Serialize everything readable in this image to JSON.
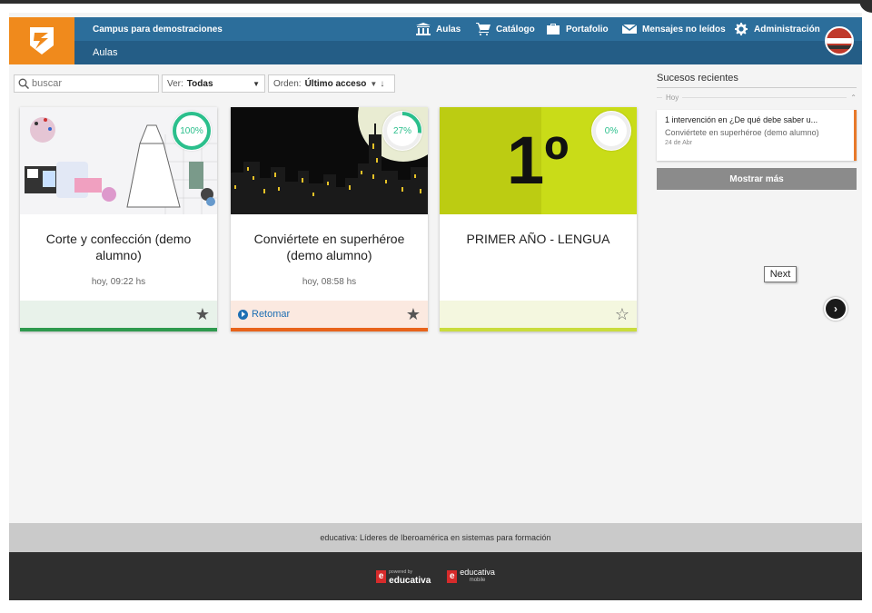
{
  "header": {
    "campus": "Campus para demostraciones",
    "section": "Aulas",
    "nav": [
      {
        "label": "Aulas",
        "icon": "building-icon"
      },
      {
        "label": "Catálogo",
        "icon": "cart-icon"
      },
      {
        "label": "Portafolio",
        "icon": "briefcase-icon"
      },
      {
        "label": "Mensajes no leídos",
        "icon": "envelope-icon"
      },
      {
        "label": "Administración",
        "icon": "gear-icon"
      }
    ]
  },
  "filters": {
    "search_placeholder": "buscar",
    "ver_label": "Ver:",
    "ver_value": "Todas",
    "orden_label": "Orden:",
    "orden_value": "Último acceso"
  },
  "courses": [
    {
      "title": "Corte y confección (demo alumno)",
      "time": "hoy, 09:22 hs",
      "progress": "100%",
      "progress_value": 1.0,
      "action": "",
      "starred": true,
      "accent": "#2e9a4e",
      "footer_bg": "#e8f2ea"
    },
    {
      "title": "Conviértete en superhéroe (demo alumno)",
      "time": "hoy, 08:58 hs",
      "progress": "27%",
      "progress_value": 0.27,
      "action": "Retomar",
      "starred": true,
      "accent": "#e8631a",
      "footer_bg": "#fbe9e0"
    },
    {
      "title": "PRIMER AÑO - LENGUA",
      "time": "",
      "progress": "0%",
      "progress_value": 0,
      "action": "",
      "starred": false,
      "accent": "#c9dc3c",
      "footer_bg": "#f4f7df",
      "image_text": "1º"
    }
  ],
  "recent": {
    "title": "Sucesos recientes",
    "group": "Hoy",
    "event_title": "1 intervención en ¿De qué debe saber u...",
    "event_course": "Conviértete en superhéroe (demo alumno)",
    "event_date": "24 de Abr",
    "more_button": "Mostrar más"
  },
  "tooltip": "Next",
  "footer": {
    "tagline": "educativa: Líderes de Iberoamérica en sistemas para formación",
    "brand1_small": "powered by",
    "brand1_big": "educativa",
    "brand2_big": "educativa",
    "brand2_small": "mobile"
  },
  "colors": {
    "header": "#2c6e9b",
    "logo_bg": "#f08a1c",
    "progress": "#2bbf8c"
  }
}
